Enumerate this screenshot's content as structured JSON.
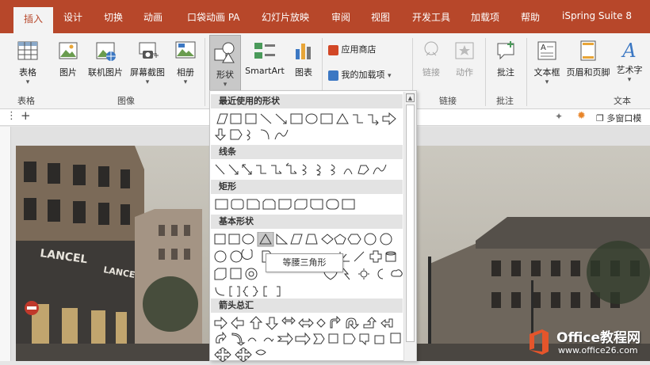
{
  "tabs": [
    "插入",
    "设计",
    "切换",
    "动画",
    "口袋动画 PA",
    "幻灯片放映",
    "审阅",
    "视图",
    "开发工具",
    "加载项",
    "帮助",
    "iSpring Suite 8"
  ],
  "ribbon": {
    "table": "表格",
    "picture": "图片",
    "online_picture": "联机图片",
    "screenshot": "屏幕截图",
    "album": "相册",
    "shapes": "形状",
    "smartart": "SmartArt",
    "chart": "图表",
    "store": "应用商店",
    "my_addins": "我的加载项",
    "link": "链接",
    "action": "动作",
    "comment": "批注",
    "textbox": "文本框",
    "header_footer": "页眉和页脚",
    "wordart": "艺术字"
  },
  "groups": {
    "table": "表格",
    "images": "图像",
    "links": "链接",
    "comments": "批注",
    "text": "文本"
  },
  "strip": {
    "add": "+",
    "multi_window": "多窗口模"
  },
  "gallery": {
    "sections": [
      "最近使用的形状",
      "线条",
      "矩形",
      "基本形状",
      "箭头总汇"
    ],
    "tooltip": "等腰三角形",
    "basic_text": [
      "⑩",
      "⑫",
      "{ }",
      "{",
      "}"
    ]
  },
  "photo": {
    "signs": [
      "LANCEL",
      "LANCEL"
    ]
  },
  "watermark": {
    "line1": "Office教程网",
    "line2": "www.office26.com"
  }
}
